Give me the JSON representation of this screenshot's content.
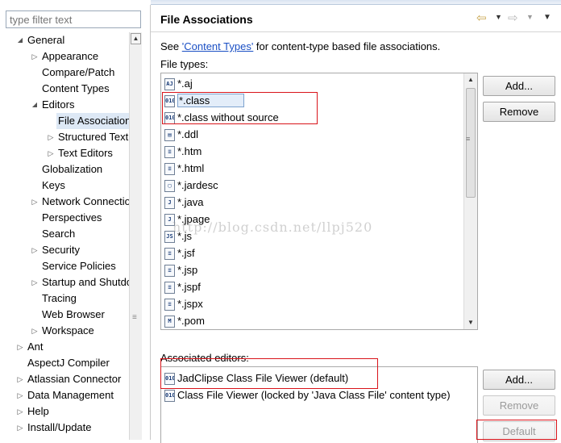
{
  "filter": {
    "placeholder": "type filter text"
  },
  "tree": [
    {
      "label": "General",
      "depth": 0,
      "expanded": true
    },
    {
      "label": "Appearance",
      "depth": 1,
      "expander": true
    },
    {
      "label": "Compare/Patch",
      "depth": 1
    },
    {
      "label": "Content Types",
      "depth": 1
    },
    {
      "label": "Editors",
      "depth": 1,
      "expanded": true
    },
    {
      "label": "File Associations",
      "depth": 2,
      "selected": true
    },
    {
      "label": "Structured Text Editors",
      "depth": 2,
      "expander": true
    },
    {
      "label": "Text Editors",
      "depth": 2,
      "expander": true
    },
    {
      "label": "Globalization",
      "depth": 1
    },
    {
      "label": "Keys",
      "depth": 1
    },
    {
      "label": "Network Connections",
      "depth": 1,
      "expander": true
    },
    {
      "label": "Perspectives",
      "depth": 1
    },
    {
      "label": "Search",
      "depth": 1
    },
    {
      "label": "Security",
      "depth": 1,
      "expander": true
    },
    {
      "label": "Service Policies",
      "depth": 1
    },
    {
      "label": "Startup and Shutdown",
      "depth": 1,
      "expander": true
    },
    {
      "label": "Tracing",
      "depth": 1
    },
    {
      "label": "Web Browser",
      "depth": 1
    },
    {
      "label": "Workspace",
      "depth": 1,
      "expander": true
    },
    {
      "label": "Ant",
      "depth": 0,
      "expander": true
    },
    {
      "label": "AspectJ Compiler",
      "depth": 0
    },
    {
      "label": "Atlassian Connector",
      "depth": 0,
      "expander": true
    },
    {
      "label": "Data Management",
      "depth": 0,
      "expander": true
    },
    {
      "label": "Help",
      "depth": 0,
      "expander": true
    },
    {
      "label": "Install/Update",
      "depth": 0,
      "expander": true
    }
  ],
  "page": {
    "title": "File Associations",
    "desc_prefix": "See ",
    "desc_link": "'Content Types'",
    "desc_suffix": " for content-type based file associations.",
    "file_types_label": "File types:",
    "editors_label": "Associated editors:"
  },
  "file_types": [
    {
      "name": "*.aj",
      "icon": "aj-file-icon",
      "glyph": "AJ"
    },
    {
      "name": "*.class",
      "icon": "class-file-icon",
      "glyph": "010",
      "selected": true
    },
    {
      "name": "*.class without source",
      "icon": "class-file-icon",
      "glyph": "010"
    },
    {
      "name": "*.ddl",
      "icon": "ddl-file-icon",
      "glyph": "▤"
    },
    {
      "name": "*.htm",
      "icon": "html-file-icon",
      "glyph": "≡"
    },
    {
      "name": "*.html",
      "icon": "html-file-icon",
      "glyph": "≡"
    },
    {
      "name": "*.jardesc",
      "icon": "jardesc-file-icon",
      "glyph": "▢"
    },
    {
      "name": "*.java",
      "icon": "java-file-icon",
      "glyph": "J"
    },
    {
      "name": "*.jpage",
      "icon": "jpage-file-icon",
      "glyph": "J"
    },
    {
      "name": "*.js",
      "icon": "js-file-icon",
      "glyph": "JS"
    },
    {
      "name": "*.jsf",
      "icon": "text-file-icon",
      "glyph": "≡"
    },
    {
      "name": "*.jsp",
      "icon": "text-file-icon",
      "glyph": "≡"
    },
    {
      "name": "*.jspf",
      "icon": "text-file-icon",
      "glyph": "≡"
    },
    {
      "name": "*.jspx",
      "icon": "text-file-icon",
      "glyph": "≡"
    },
    {
      "name": "*.pom",
      "icon": "maven-file-icon",
      "glyph": "M"
    }
  ],
  "editors": [
    {
      "name": "JadClipse Class File Viewer (default)",
      "icon": "class-file-icon",
      "glyph": "010"
    },
    {
      "name": "Class File Viewer (locked by 'Java Class File' content type)",
      "icon": "class-file-icon",
      "glyph": "010"
    }
  ],
  "buttons": {
    "add_types": "Add...",
    "remove_types": "Remove",
    "add_editor": "Add...",
    "remove_editor": "Remove",
    "default_editor": "Default"
  },
  "watermark": "http://blog.csdn.net/llpj520",
  "colors": {
    "highlight_box": "#d9141a",
    "link": "#1a4fc4",
    "selection": "#e3edf9"
  }
}
